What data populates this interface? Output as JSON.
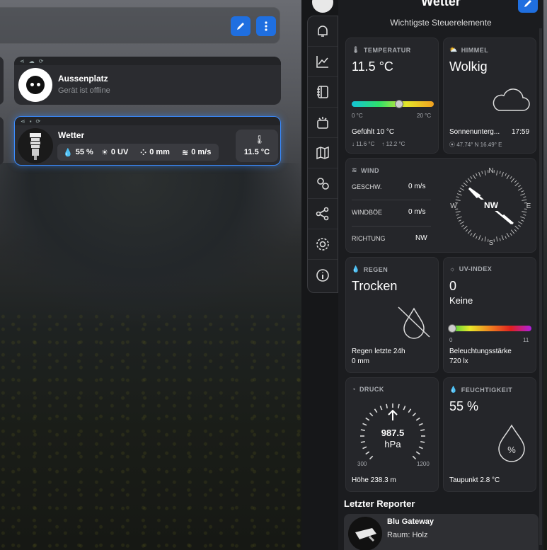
{
  "header": {
    "title": "Wetter",
    "subtitle": "Wichtigste Steuerelemente"
  },
  "devices": [
    {
      "name": "Aussenplatz",
      "status": "Gerät ist offline"
    },
    {
      "name": "Wetter",
      "humidity": "55 %",
      "uv": "0 UV",
      "rain": "0 mm",
      "wind": "0 m/s",
      "temp": "11.5 °C"
    }
  ],
  "sidebar": [
    "bell-icon",
    "chart-icon",
    "notebook-icon",
    "sensors-icon",
    "map-icon",
    "cogs-icon",
    "share-icon",
    "settings-icon",
    "info-icon"
  ],
  "temperature": {
    "label": "TEMPERATUR",
    "value": "11.5 °C",
    "min_label": "0 °C",
    "max_label": "20 °C",
    "level": 0.575,
    "feels": "Gefühlt 10 °C",
    "low": "11.6 °C",
    "high": "12.2 °C"
  },
  "sky": {
    "label": "HIMMEL",
    "value": "Wolkig",
    "sunset_label": "Sonnenunterg...",
    "sunset_time": "17:59",
    "location": "47.74° N 16.49° E"
  },
  "wind": {
    "label": "WIND",
    "speed_label": "GESCHW.",
    "speed": "0 m/s",
    "gust_label": "WINDBÖE",
    "gust": "0 m/s",
    "dir_label": "RICHTUNG",
    "dir": "NW",
    "compass_dir": "NW",
    "n": "N",
    "e": "E",
    "s": "S",
    "w": "W"
  },
  "rain": {
    "label": "REGEN",
    "value": "Trocken",
    "last24_label": "Regen letzte 24h",
    "last24": "0 mm"
  },
  "uv": {
    "label": "UV-INDEX",
    "value": "0",
    "desc": "Keine",
    "min": "0",
    "max": "11",
    "level": 0.0,
    "lux_label": "Beleuchtungsstärke",
    "lux": "720 lx"
  },
  "pressure": {
    "label": "DRUCK",
    "value": "987.5",
    "unit": "hPa",
    "min": "300",
    "max": "1200",
    "altitude": "Höhe 238.3 m"
  },
  "humidity": {
    "label": "FEUCHTIGKEIT",
    "value": "55 %",
    "dewpoint": "Taupunkt 2.8 °C"
  },
  "reporter": {
    "title": "Letzter Reporter",
    "name": "Blu Gateway",
    "room": "Raum: Holz"
  },
  "colors": {
    "accent": "#1f6fe0",
    "panel": "#1b1c1f",
    "tile": "#25262a"
  }
}
